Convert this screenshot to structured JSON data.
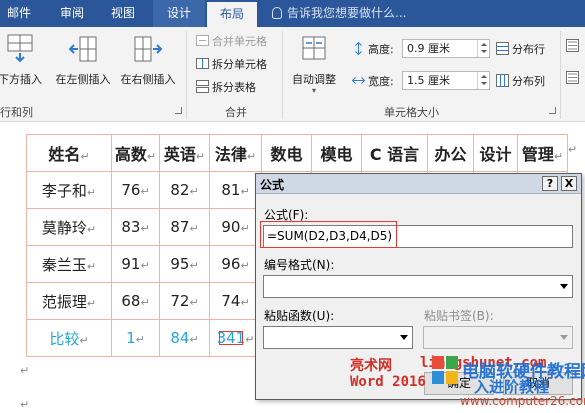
{
  "ribbon": {
    "tabs": [
      "邮件",
      "审阅",
      "视图",
      "设计",
      "布局"
    ],
    "active_tab": "布局",
    "tell_me": "告诉我您想要做什么...",
    "rows_cols": {
      "insert_below": "下方插入",
      "insert_left": "在左侧插入",
      "insert_right": "在右侧插入",
      "group_label": "行和列"
    },
    "merge": {
      "merge_cells": "合并单元格",
      "split_cells": "拆分单元格",
      "split_table": "拆分表格",
      "group_label": "合并"
    },
    "cell_size": {
      "autofit": "自动调整",
      "height_label": "高度:",
      "height_value": "0.9 厘米",
      "width_label": "宽度:",
      "width_value": "1.5 厘米",
      "distribute_rows": "分布行",
      "distribute_cols": "分布列",
      "group_label": "单元格大小"
    }
  },
  "table": {
    "headers": [
      "姓名",
      "高数",
      "英语",
      "法律",
      "数电",
      "模电",
      "C 语言",
      "办公",
      "设计",
      "管理"
    ],
    "rows": [
      {
        "name": "李子和",
        "values": [
          "76",
          "82",
          "81"
        ]
      },
      {
        "name": "莫静玲",
        "values": [
          "83",
          "87",
          "90"
        ]
      },
      {
        "name": "秦兰玉",
        "values": [
          "91",
          "95",
          "96"
        ]
      },
      {
        "name": "范振理",
        "values": [
          "68",
          "72",
          "74"
        ]
      }
    ],
    "compare": {
      "label": "比较",
      "values": [
        "1",
        "84",
        "341"
      ]
    }
  },
  "dialog": {
    "title": "公式",
    "help_btn": "?",
    "close_btn": "X",
    "formula_label": "公式(F):",
    "formula_value": "=SUM(D2,D3,D4,D5)",
    "number_format_label": "编号格式(N):",
    "paste_function_label": "粘贴函数(U):",
    "paste_bookmark_label": "粘贴书签(B):",
    "ok": "确定",
    "cancel": "取消"
  },
  "watermarks": {
    "site1_line1": "亮术网",
    "site1_url": "liangshunet.com",
    "site1_line2": "Word 2016",
    "site2_line1": "电脑软硬件教程网",
    "site2_line2": "入进阶教程",
    "site2_url": "www.computer26.com"
  },
  "colors": {
    "ribbon_blue": "#2b579a",
    "table_border": "#f0b3a4",
    "highlight_red": "#e23a2e",
    "compare_text": "#25a6d9"
  }
}
